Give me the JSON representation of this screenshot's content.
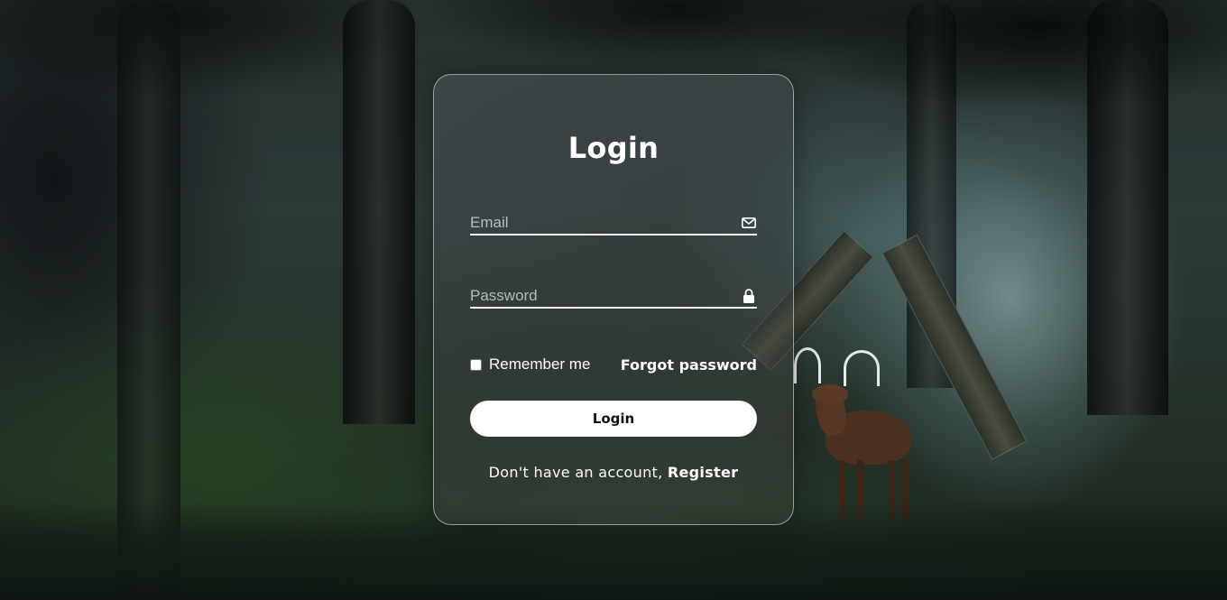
{
  "login_form": {
    "title": "Login",
    "email": {
      "placeholder": "Email",
      "value": "",
      "icon": "envelope-icon"
    },
    "password": {
      "placeholder": "Password",
      "value": "",
      "icon": "lock-icon"
    },
    "remember_label": "Remember me",
    "remember_checked": false,
    "forgot_label": "Forgot password",
    "submit_label": "Login",
    "register_prompt": "Don't have an account,",
    "register_label": "Register"
  },
  "colors": {
    "card_border": "#ffffff",
    "text": "#ffffff",
    "button_bg": "#ffffff",
    "button_text": "#111111"
  }
}
